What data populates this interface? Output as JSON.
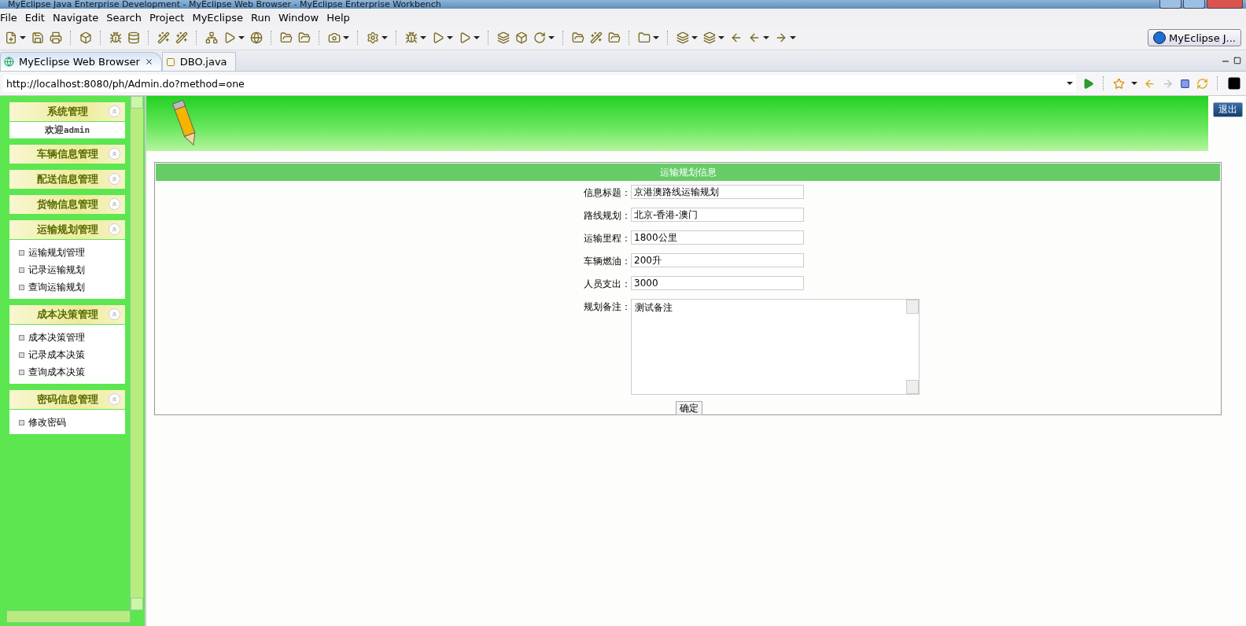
{
  "window": {
    "title": "MyEclipse Java Enterprise Development - MyEclipse Web Browser - MyEclipse Enterprise Workbench"
  },
  "menu": [
    "File",
    "Edit",
    "Navigate",
    "Search",
    "Project",
    "MyEclipse",
    "Run",
    "Window",
    "Help"
  ],
  "perspective": {
    "label": "MyEclipse J..."
  },
  "editor_tabs": [
    {
      "label": "MyEclipse Web Browser",
      "selected": true
    },
    {
      "label": "DBO.java",
      "selected": false
    }
  ],
  "address": {
    "value": "http://localhost:8080/ph/Admin.do?method=one"
  },
  "sidebar": {
    "sections": [
      {
        "title": "系统管理",
        "welcome": "欢迎",
        "user": "admin"
      },
      {
        "title": "车辆信息管理"
      },
      {
        "title": "配送信息管理"
      },
      {
        "title": "货物信息管理"
      },
      {
        "title": "运输规划管理",
        "items": [
          "运输规划管理",
          "记录运输规划",
          "查询运输规划"
        ]
      },
      {
        "title": "成本决策管理",
        "items": [
          "成本决策管理",
          "记录成本决策",
          "查询成本决策"
        ]
      },
      {
        "title": "密码信息管理",
        "items": [
          "修改密码"
        ]
      }
    ]
  },
  "header": {
    "logout": "退出"
  },
  "form": {
    "title": "运输规划信息",
    "fields": [
      {
        "kind": "input",
        "label": "信息标题：",
        "value": "京港澳路线运输规划"
      },
      {
        "kind": "input",
        "label": "路线规划：",
        "value": "北京-香港-澳门"
      },
      {
        "kind": "input",
        "label": "运输里程：",
        "value": "1800公里"
      },
      {
        "kind": "input",
        "label": "车辆燃油：",
        "value": "200升"
      },
      {
        "kind": "input",
        "label": "人员支出：",
        "value": "3000"
      },
      {
        "kind": "textarea",
        "label": "规划备注：",
        "value": "测试备注"
      }
    ],
    "submit": "确定"
  }
}
